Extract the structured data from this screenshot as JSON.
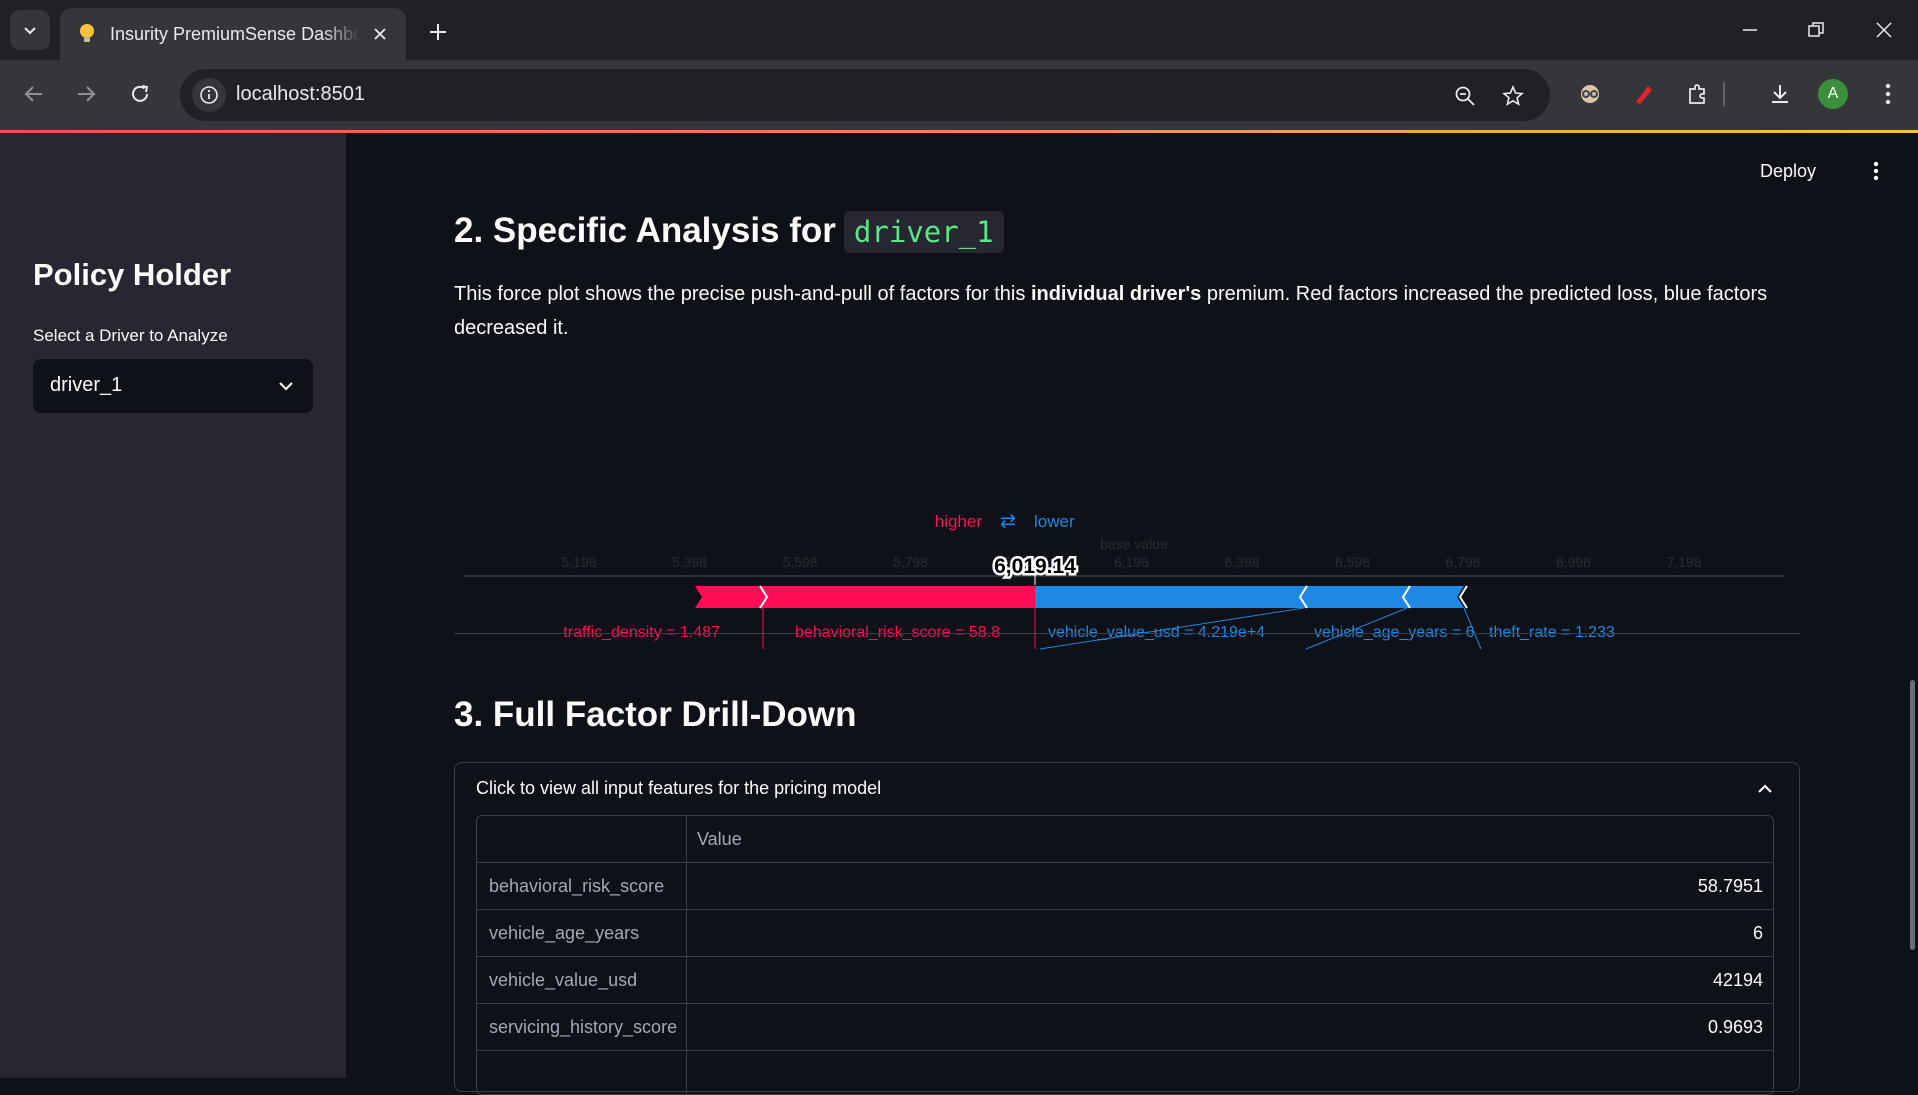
{
  "browser": {
    "tab_title": "Insurity PremiumSense Dashboard",
    "url": "localhost:8501",
    "profile_initial": "A"
  },
  "sidebar": {
    "title": "Policy Holder",
    "select_label": "Select a Driver to Analyze",
    "selected_driver": "driver_1"
  },
  "header": {
    "deploy_label": "Deploy"
  },
  "section2": {
    "heading": "2. Specific Analysis for",
    "driver_code": "driver_1",
    "para_1": "This force plot shows the precise push-and-pull of factors for this ",
    "para_bold": "individual driver's",
    "para_2": " premium. Red factors increased the predicted loss, blue factors decreased it."
  },
  "chart_data": {
    "type": "force",
    "legend_higher": "higher",
    "legend_arrows": "⇄",
    "legend_lower": "lower",
    "base_value_label": "base value",
    "output_value": 6019.14,
    "output_label": "6,019.14",
    "axis_ticks": [
      5.198,
      5.398,
      5.598,
      5.798,
      5.998,
      6.198,
      6.398,
      6.598,
      6.798,
      6.998,
      7.198
    ],
    "axis_tick_labels": [
      "5,198",
      "5,398",
      "5,598",
      "5,798",
      "5,998",
      "6,198",
      "6,398",
      "6,598",
      "6,798",
      "6,998",
      "7,198"
    ],
    "positive_features": [
      {
        "label": "traffic_density = 1.487",
        "value": 1.487
      },
      {
        "label": "behavioral_risk_score = 58.8",
        "value": 58.8
      }
    ],
    "negative_features": [
      {
        "label": "vehicle_value_usd = 4.219e+4",
        "value": 42190
      },
      {
        "label": "vehicle_age_years = 6",
        "value": 6
      },
      {
        "label": "theft_rate = 1.233",
        "value": 1.233
      }
    ],
    "colors": {
      "positive": "#ff0d57",
      "negative": "#1e88e5"
    }
  },
  "section3": {
    "heading": "3. Full Factor Drill-Down",
    "expander_label": "Click to view all input features for the pricing model",
    "column_header": "Value",
    "rows": [
      {
        "name": "behavioral_risk_score",
        "value": "58.7951"
      },
      {
        "name": "vehicle_age_years",
        "value": "6"
      },
      {
        "name": "vehicle_value_usd",
        "value": "42194"
      },
      {
        "name": "servicing_history_score",
        "value": "0.9693"
      }
    ]
  }
}
